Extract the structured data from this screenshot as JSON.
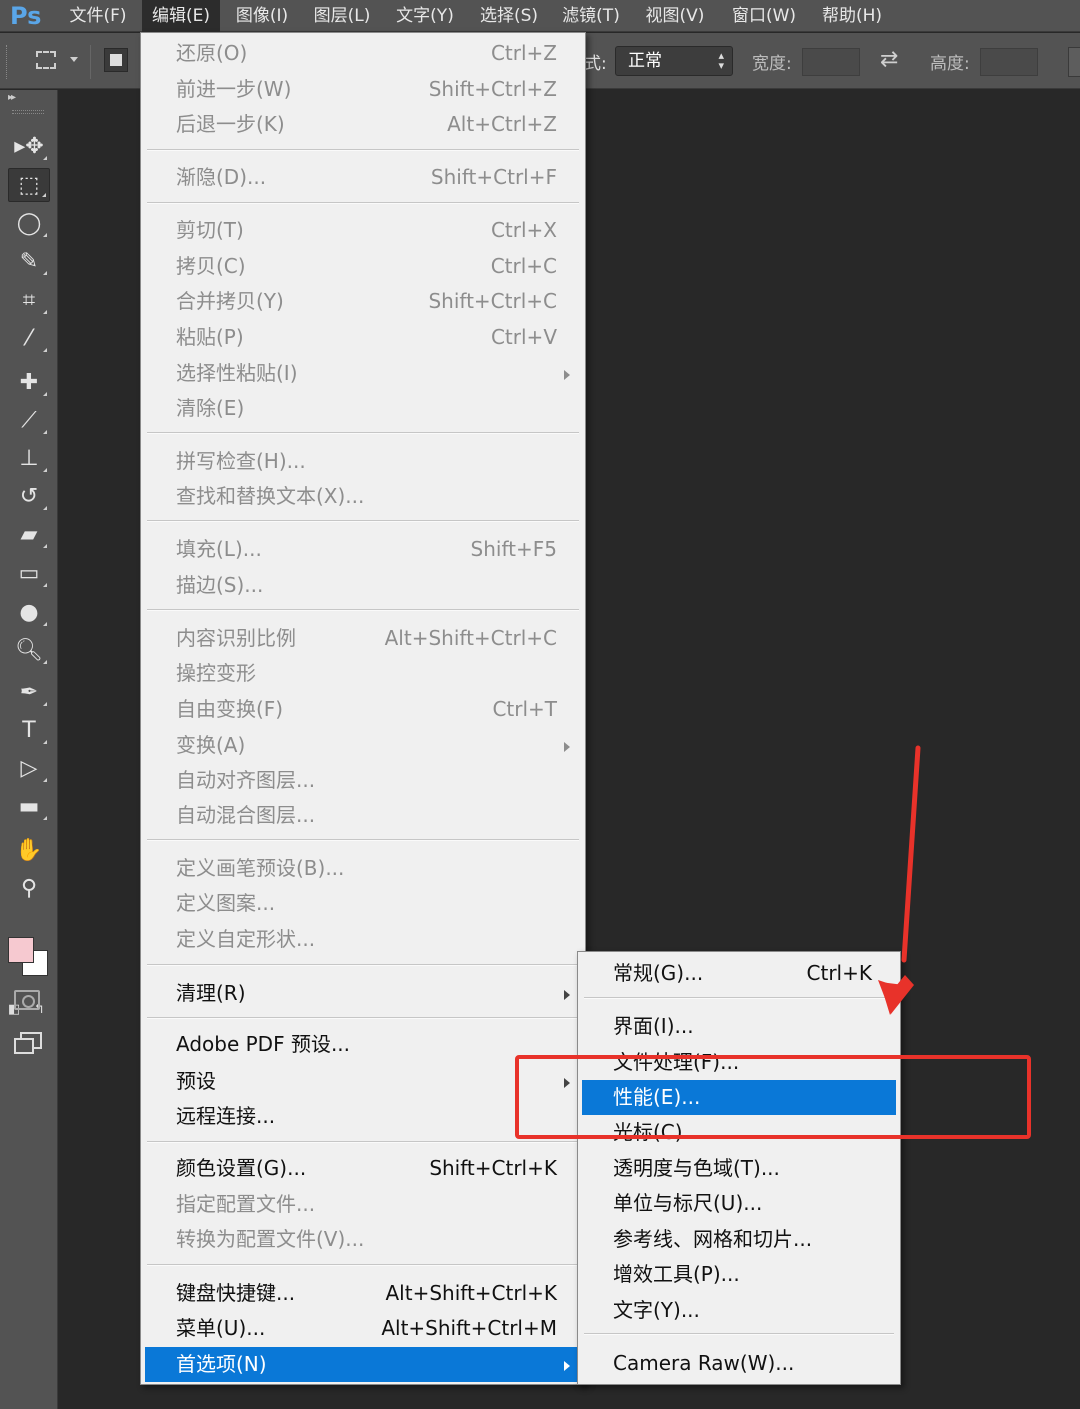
{
  "app": {
    "logo": "Ps"
  },
  "menubar": {
    "items": [
      "文件(F)",
      "编辑(E)",
      "图像(I)",
      "图层(L)",
      "文字(Y)",
      "选择(S)",
      "滤镜(T)",
      "视图(V)",
      "窗口(W)",
      "帮助(H)"
    ],
    "active": "编辑(E)"
  },
  "options_bar": {
    "style_label": "式:",
    "style_value": "正常",
    "width_label": "宽度:",
    "height_label": "高度:"
  },
  "toolbox": {
    "tools": [
      "move-tool-icon",
      "rect-marquee-icon",
      "lasso-icon",
      "quick-select-icon",
      "crop-icon",
      "eyedropper-icon",
      "healing-brush-icon",
      "brush-icon",
      "clone-stamp-icon",
      "history-brush-icon",
      "eraser-icon",
      "gradient-icon",
      "blur-icon",
      "dodge-icon",
      "pen-icon",
      "type-icon",
      "path-select-icon",
      "rectangle-shape-icon",
      "hand-icon",
      "zoom-icon"
    ],
    "foreground_color": "#f6c9d0",
    "background_color": "#ffffff"
  },
  "edit_menu": {
    "items": [
      {
        "label": "还原(O)",
        "shortcut": "Ctrl+Z",
        "disabled": true
      },
      {
        "label": "前进一步(W)",
        "shortcut": "Shift+Ctrl+Z",
        "disabled": true
      },
      {
        "label": "后退一步(K)",
        "shortcut": "Alt+Ctrl+Z",
        "disabled": true
      },
      {
        "label": "渐隐(D)...",
        "shortcut": "Shift+Ctrl+F",
        "disabled": true
      },
      {
        "label": "剪切(T)",
        "shortcut": "Ctrl+X",
        "disabled": true
      },
      {
        "label": "拷贝(C)",
        "shortcut": "Ctrl+C",
        "disabled": true
      },
      {
        "label": "合并拷贝(Y)",
        "shortcut": "Shift+Ctrl+C",
        "disabled": true
      },
      {
        "label": "粘贴(P)",
        "shortcut": "Ctrl+V",
        "disabled": true
      },
      {
        "label": "选择性粘贴(I)",
        "shortcut": "",
        "disabled": true,
        "submenu": true
      },
      {
        "label": "清除(E)",
        "shortcut": "",
        "disabled": true
      },
      {
        "label": "拼写检查(H)...",
        "shortcut": "",
        "disabled": true
      },
      {
        "label": "查找和替换文本(X)...",
        "shortcut": "",
        "disabled": true
      },
      {
        "label": "填充(L)...",
        "shortcut": "Shift+F5",
        "disabled": true
      },
      {
        "label": "描边(S)...",
        "shortcut": "",
        "disabled": true
      },
      {
        "label": "内容识别比例",
        "shortcut": "Alt+Shift+Ctrl+C",
        "disabled": true
      },
      {
        "label": "操控变形",
        "shortcut": "",
        "disabled": true
      },
      {
        "label": "自由变换(F)",
        "shortcut": "Ctrl+T",
        "disabled": true
      },
      {
        "label": "变换(A)",
        "shortcut": "",
        "disabled": true,
        "submenu": true
      },
      {
        "label": "自动对齐图层...",
        "shortcut": "",
        "disabled": true
      },
      {
        "label": "自动混合图层...",
        "shortcut": "",
        "disabled": true
      },
      {
        "label": "定义画笔预设(B)...",
        "shortcut": "",
        "disabled": true
      },
      {
        "label": "定义图案...",
        "shortcut": "",
        "disabled": true
      },
      {
        "label": "定义自定形状...",
        "shortcut": "",
        "disabled": true
      },
      {
        "label": "清理(R)",
        "shortcut": "",
        "disabled": false,
        "submenu": true
      },
      {
        "label": "Adobe PDF 预设...",
        "shortcut": "",
        "disabled": false
      },
      {
        "label": "预设",
        "shortcut": "",
        "disabled": false,
        "submenu": true
      },
      {
        "label": "远程连接...",
        "shortcut": "",
        "disabled": false
      },
      {
        "label": "颜色设置(G)...",
        "shortcut": "Shift+Ctrl+K",
        "disabled": false
      },
      {
        "label": "指定配置文件...",
        "shortcut": "",
        "disabled": true
      },
      {
        "label": "转换为配置文件(V)...",
        "shortcut": "",
        "disabled": true
      },
      {
        "label": "键盘快捷键...",
        "shortcut": "Alt+Shift+Ctrl+K",
        "disabled": false
      },
      {
        "label": "菜单(U)...",
        "shortcut": "Alt+Shift+Ctrl+M",
        "disabled": false
      },
      {
        "label": "首选项(N)",
        "shortcut": "",
        "disabled": false,
        "submenu": true,
        "selected": true
      }
    ]
  },
  "preferences_submenu": {
    "items": [
      {
        "label": "常规(G)...",
        "shortcut": "Ctrl+K"
      },
      {
        "label": "界面(I)...",
        "shortcut": ""
      },
      {
        "label": "文件处理(F)...",
        "shortcut": ""
      },
      {
        "label": "性能(E)...",
        "shortcut": "",
        "selected": true
      },
      {
        "label": "光标(C)...",
        "shortcut": ""
      },
      {
        "label": "透明度与色域(T)...",
        "shortcut": ""
      },
      {
        "label": "单位与标尺(U)...",
        "shortcut": ""
      },
      {
        "label": "参考线、网格和切片...",
        "shortcut": ""
      },
      {
        "label": "增效工具(P)...",
        "shortcut": ""
      },
      {
        "label": "文字(Y)...",
        "shortcut": ""
      },
      {
        "label": "Camera Raw(W)...",
        "shortcut": ""
      }
    ]
  },
  "annotation": {
    "color": "#e8322a"
  }
}
